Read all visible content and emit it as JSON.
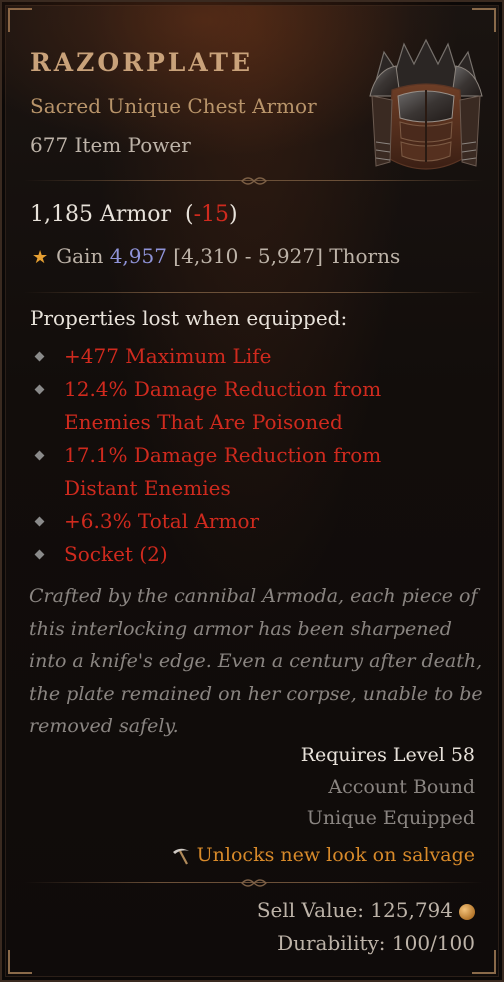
{
  "item": {
    "name": "RAZORPLATE",
    "type": "Sacred Unique Chest Armor",
    "item_power": "677 Item Power"
  },
  "armor": {
    "value": "1,185 Armor",
    "delta_open": "(",
    "delta": "-15",
    "delta_close": ")"
  },
  "unique_affix": {
    "prefix": "Gain ",
    "value": "4,957",
    "range": " [4,310 - 5,927] ",
    "suffix": "Thorns"
  },
  "properties_lost": {
    "label": "Properties lost when equipped:",
    "items": [
      "+477 Maximum Life",
      "12.4% Damage Reduction from Enemies That Are Poisoned",
      "17.1% Damage Reduction from Distant Enemies",
      "+6.3% Total Armor",
      "Socket (2)"
    ]
  },
  "flavor_text": "Crafted by the cannibal Armoda, each piece of this interlocking armor has been sharpened into a knife's edge. Even a century after death, the plate remained on her corpse, unable to be removed safely.",
  "requirements": {
    "level": "Requires Level 58",
    "bound": "Account Bound",
    "unique_equipped": "Unique Equipped"
  },
  "salvage_note": "Unlocks new look on salvage",
  "footer": {
    "sell_value": "Sell Value: 125,794",
    "durability": "Durability: 100/100"
  },
  "icons": {
    "star": "star-icon",
    "bullet": "diamond-bullet-icon",
    "salvage": "pickaxe-icon",
    "gold": "gold-coin-icon"
  },
  "colors": {
    "title": "#c9a27a",
    "lost_property": "#d02a1e",
    "thorns_value": "#8f93d8",
    "salvage": "#d88a2a"
  }
}
